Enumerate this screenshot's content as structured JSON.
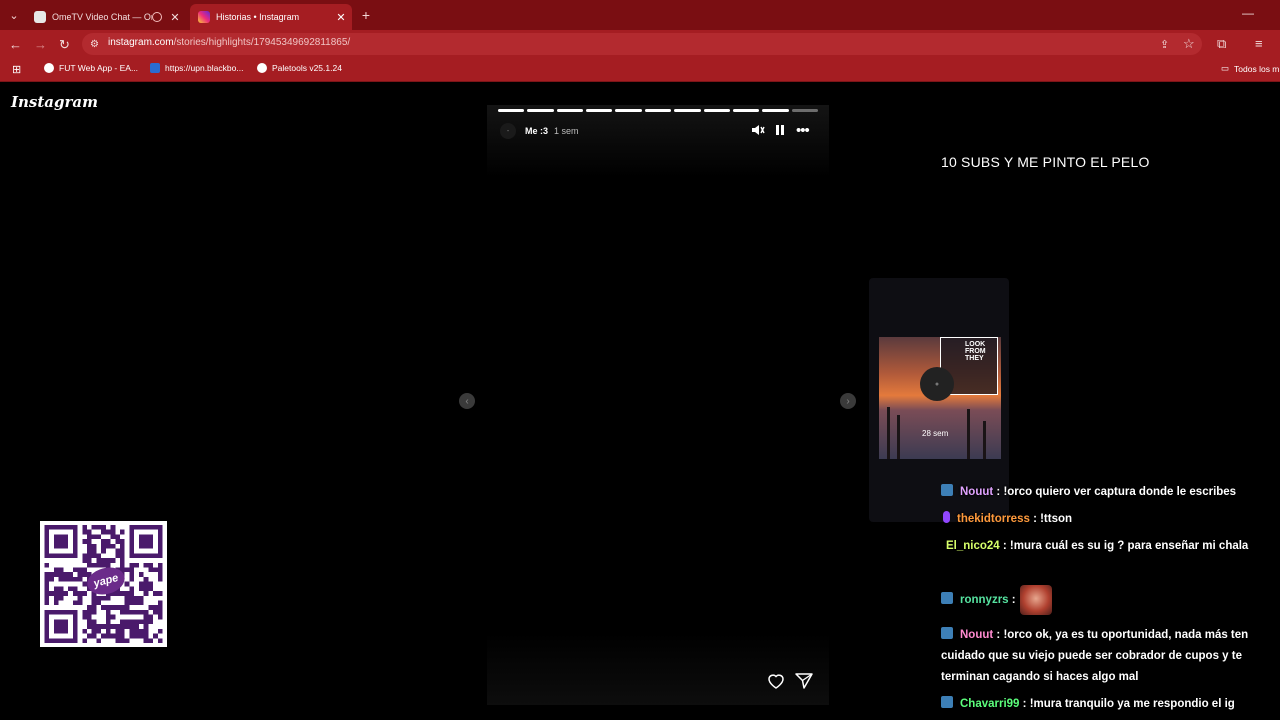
{
  "browser": {
    "tabs": [
      {
        "title": "OmeTV Video Chat — Ome",
        "close": "✕",
        "active": false
      },
      {
        "title": "Historias • Instagram",
        "close": "✕",
        "active": true
      }
    ],
    "new_tab": "+",
    "url_host": "instagram.com",
    "url_path": "/stories/highlights/17945349692811865/",
    "bookmarks": [
      "FUT Web App - EA...",
      "https://upn.blackbo...",
      "Paletools v25.1.24"
    ],
    "bookmarks_folder": "Todos los m",
    "window_controls": {
      "minimize": "—",
      "maximize": "☐",
      "close": "✕"
    }
  },
  "instagram": {
    "logo": "Instagram",
    "story": {
      "user": "Me :3",
      "time": "1 sem",
      "segments_total": 11,
      "segments_viewed": 10,
      "avatar_mark": "-"
    },
    "next_preview": {
      "time": "28 sem",
      "sticker_text": "LOOK FROM THEY"
    }
  },
  "stream_overlay": {
    "title": "10 SUBS Y ME PINTO EL PELO"
  },
  "chat": [
    {
      "user": "Nouut",
      "message": ": !orco quiero ver captura donde le escribes",
      "badge": "prime"
    },
    {
      "user": "thekidtorress",
      "message": ": !ttson",
      "badge": "mic"
    },
    {
      "user": "El_nico24",
      "message": ": !mura cuál es su ig ? para enseñar mi chala",
      "badge": "none"
    },
    {
      "user": "ronnyzrs",
      "message": ":",
      "badge": "prime"
    },
    {
      "user": "Nouut",
      "message": ": !orco ok, ya es tu oportunidad, nada más ten cuidado que su viejo puede ser cobrador de cupos y te terminan cagando si haces algo mal",
      "badge": "prime"
    },
    {
      "user": "Chavarri99",
      "message": ": !mura tranquilo ya me respondio el ig",
      "badge": "prime"
    }
  ],
  "qr": {
    "brand": "yape"
  }
}
